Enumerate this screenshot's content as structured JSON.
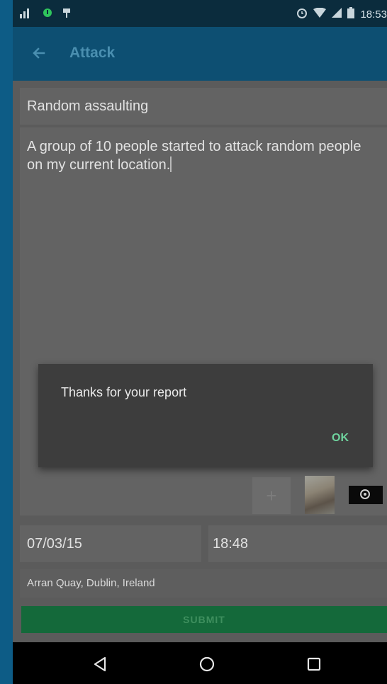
{
  "status_bar": {
    "time": "18:53"
  },
  "app_bar": {
    "title": "Attack"
  },
  "form": {
    "subject": "Random assaulting",
    "description": "A group of 10 people started to attack random people on my current location.",
    "date": "07/03/15",
    "time": "18:48",
    "location": "Arran Quay, Dublin, Ireland",
    "submit_label": "SUBMIT"
  },
  "dialog": {
    "message": "Thanks for your report",
    "ok_label": "OK"
  },
  "icons": {
    "back": "arrow-back-icon",
    "add_attachment": "plus-icon",
    "video": "play-icon",
    "nav_back": "triangle-back-icon",
    "nav_home": "circle-home-icon",
    "nav_recents": "square-recents-icon"
  },
  "colors": {
    "status_bar": "#0b2c3d",
    "app_bar": "#0d4f72",
    "submit": "#14693a",
    "dialog": "#3d3d3d",
    "dialog_accent": "#6fd39e"
  }
}
